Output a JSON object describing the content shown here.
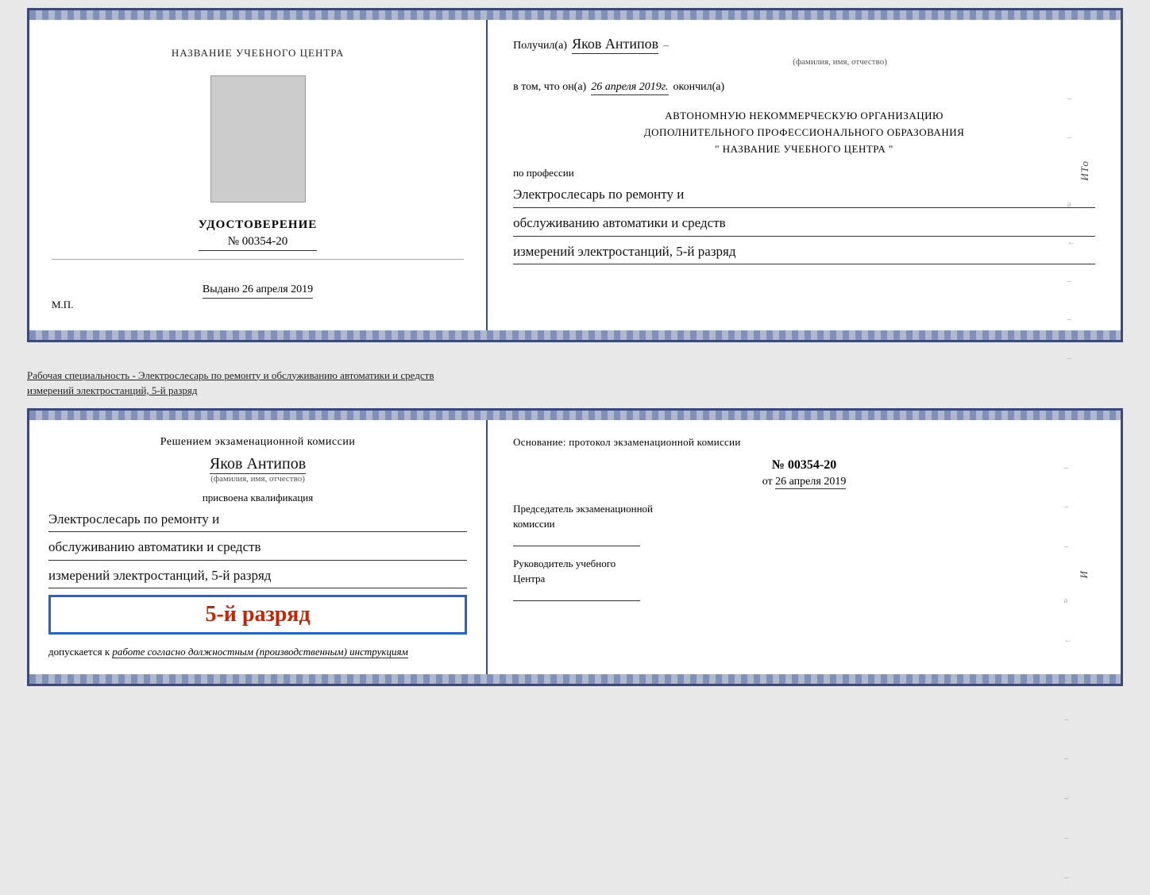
{
  "top_cert": {
    "left": {
      "center_title": "НАЗВАНИЕ УЧЕБНОГО ЦЕНТРА",
      "udostoverenie": "УДОСТОВЕРЕНИЕ",
      "number": "№ 00354-20",
      "vidano_label": "Выдано",
      "vidano_date": "26 апреля 2019",
      "mp": "М.П."
    },
    "right": {
      "poluchil_label": "Получил(а)",
      "poluchil_name": "Яков Антипов",
      "fio_small": "(фамилия, имя, отчество)",
      "dash": "–",
      "vtom_label": "в том, что он(а)",
      "vtom_date": "26 апреля 2019г.",
      "okonchil": "окончил(а)",
      "org_line1": "АВТОНОМНУЮ НЕКОММЕРЧЕСКУЮ ОРГАНИЗАЦИЮ",
      "org_line2": "ДОПОЛНИТЕЛЬНОГО ПРОФЕССИОНАЛЬНОГО ОБРАЗОВАНИЯ",
      "org_quote1": "\"",
      "org_name": "НАЗВАНИЕ УЧЕБНОГО ЦЕНТРА",
      "org_quote2": "\"",
      "po_professii": "по профессии",
      "prof_line1": "Электрослесарь по ремонту и",
      "prof_line2": "обслуживанию автоматики и средств",
      "prof_line3": "измерений электростанций, 5-й разряд"
    }
  },
  "between_label": "Рабочая специальность - Электрослесарь по ремонту и обслуживанию автоматики и средств\nизмерений электростанций, 5-й разряд",
  "bottom_cert": {
    "left": {
      "resheniem": "Решением экзаменационной комиссии",
      "name": "Яков Антипов",
      "fio_small": "(фамилия, имя, отчество)",
      "prisvoena": "присвоена квалификация",
      "qual_line1": "Электрослесарь по ремонту и",
      "qual_line2": "обслуживанию автоматики и средств",
      "qual_line3": "измерений электростанций, 5-й разряд",
      "rank_badge": "5-й разряд",
      "dopuskaetsya_label": "допускается к",
      "dopusk_text": "работе согласно должностным (производственным) инструкциям"
    },
    "right": {
      "osnovanie": "Основание: протокол экзаменационной комиссии",
      "prot_number": "№  00354-20",
      "ot_label": "от",
      "prot_date": "26 апреля 2019",
      "predsedatel_line1": "Председатель экзаменационной",
      "predsedatel_line2": "комиссии",
      "ruk_line1": "Руководитель учебного",
      "ruk_line2": "Центра"
    }
  }
}
